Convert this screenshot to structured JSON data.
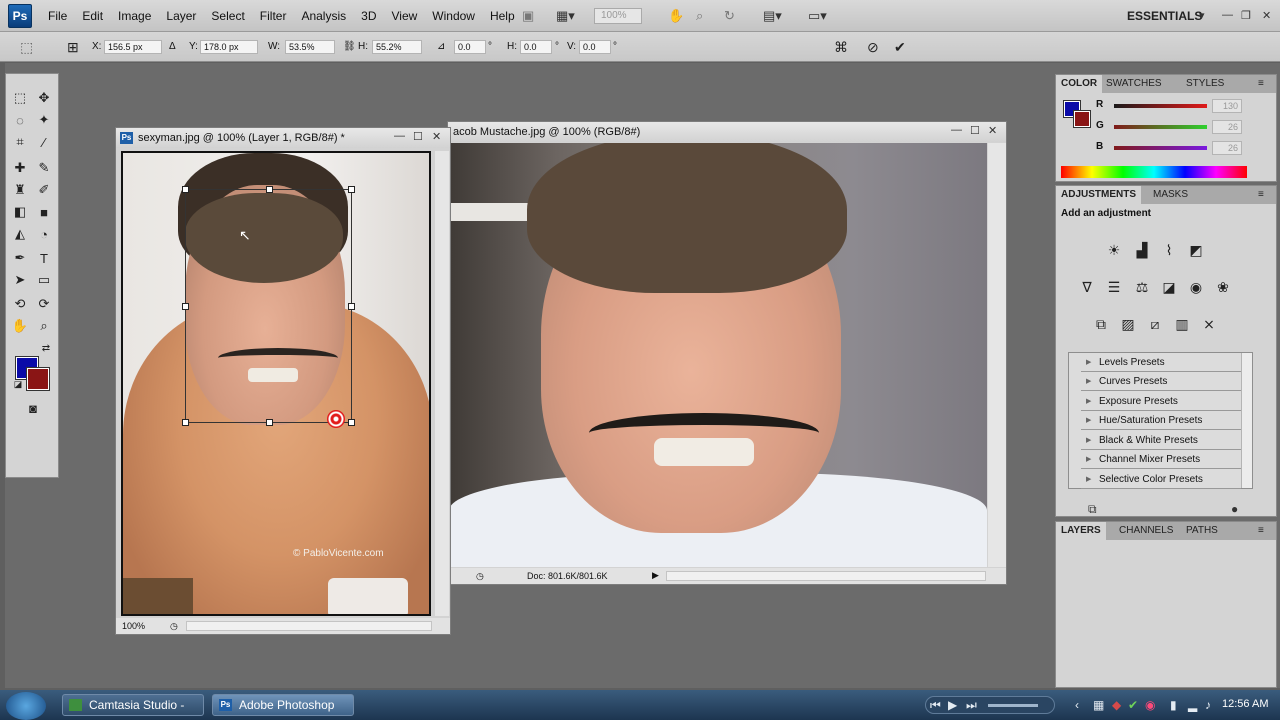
{
  "app": {
    "logo": "Ps"
  },
  "menu": [
    "File",
    "Edit",
    "Image",
    "Layer",
    "Select",
    "Filter",
    "Analysis",
    "3D",
    "View",
    "Window",
    "Help"
  ],
  "menubar": {
    "zoom": "100%",
    "workspace": "ESSENTIALS"
  },
  "options": {
    "x_label": "X:",
    "x_value": "156.5 px",
    "y_label": "Y:",
    "y_value": "178.0 px",
    "w_label": "W:",
    "w_value": "53.5%",
    "h_label": "H:",
    "h_value": "55.2%",
    "angle_value": "0.0",
    "angle_unit": "°",
    "hskew_label": "H:",
    "hskew_value": "0.0",
    "hskew_unit": "°",
    "vskew_label": "V:",
    "vskew_value": "0.0",
    "vskew_unit": "°"
  },
  "doc1": {
    "title": "sexyman.jpg @ 100% (Layer 1, RGB/8#) *",
    "zoom": "100%",
    "watermark": "© PabloVicente.com"
  },
  "doc2": {
    "title": "acob Mustache.jpg @ 100% (RGB/8#)",
    "status": "Doc: 801.6K/801.6K"
  },
  "color_panel": {
    "tabs": [
      "COLOR",
      "SWATCHES",
      "STYLES"
    ],
    "r_label": "R",
    "r_value": "130",
    "g_label": "G",
    "g_value": "26",
    "b_label": "B",
    "b_value": "26",
    "foreground": "#0a0aa8",
    "background": "#8a1515"
  },
  "adjustments_panel": {
    "tabs": [
      "ADJUSTMENTS",
      "MASKS"
    ],
    "heading": "Add an adjustment",
    "presets": [
      "Levels Presets",
      "Curves Presets",
      "Exposure Presets",
      "Hue/Saturation Presets",
      "Black & White Presets",
      "Channel Mixer Presets",
      "Selective Color Presets"
    ]
  },
  "layers_panel": {
    "tabs": [
      "LAYERS",
      "CHANNELS",
      "PATHS"
    ]
  },
  "taskbar": {
    "items": [
      "Camtasia Studio - U...",
      "Adobe Photoshop C..."
    ],
    "clock": "12:56 AM"
  }
}
